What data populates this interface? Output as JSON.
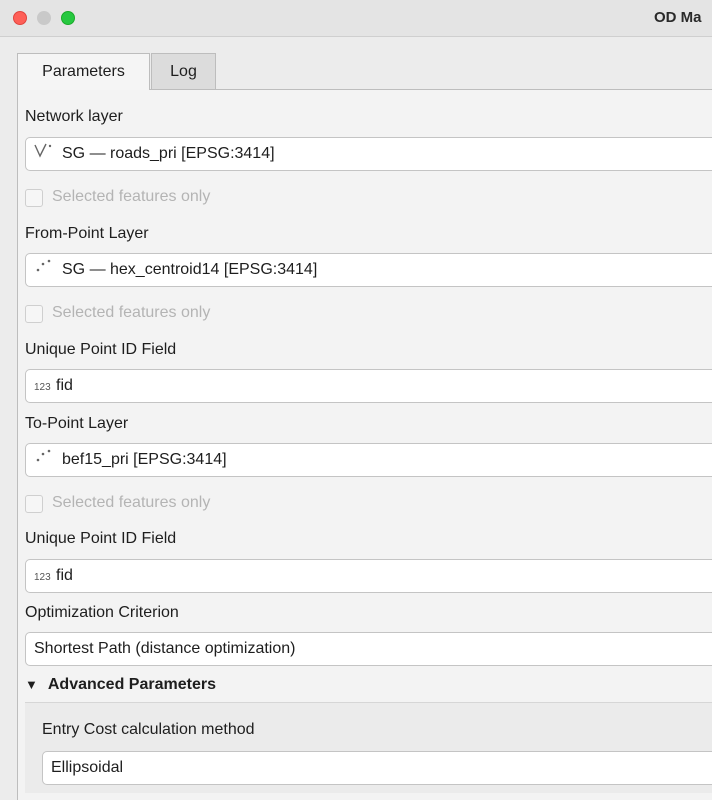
{
  "window": {
    "title": "OD Ma"
  },
  "tabs": [
    {
      "label": "Parameters",
      "active": true
    },
    {
      "label": "Log",
      "active": false
    }
  ],
  "network_layer": {
    "label": "Network layer",
    "icon": "line-layer-icon",
    "value": "SG — roads_pri [EPSG:3414]",
    "selected_only": "Selected features only"
  },
  "from_point_layer": {
    "label": "From-Point Layer",
    "icon": "point-layer-icon",
    "value": "SG — hex_centroid14 [EPSG:3414]",
    "selected_only": "Selected features only"
  },
  "from_id_field": {
    "label": "Unique Point ID Field",
    "icon_text": "123",
    "value": "fid"
  },
  "to_point_layer": {
    "label": "To-Point Layer",
    "icon": "point-layer-icon",
    "value": "bef15_pri [EPSG:3414]",
    "selected_only": "Selected features only"
  },
  "to_id_field": {
    "label": "Unique Point ID Field",
    "icon_text": "123",
    "value": "fid"
  },
  "optimization": {
    "label": "Optimization Criterion",
    "value": "Shortest Path (distance optimization)"
  },
  "advanced": {
    "header": "Advanced Parameters",
    "entry_cost": {
      "label": "Entry Cost calculation method",
      "value": "Ellipsoidal"
    }
  },
  "colors": {
    "close": "#fe5f57",
    "minimize": "#c9c9c9",
    "maximize": "#27c840"
  }
}
